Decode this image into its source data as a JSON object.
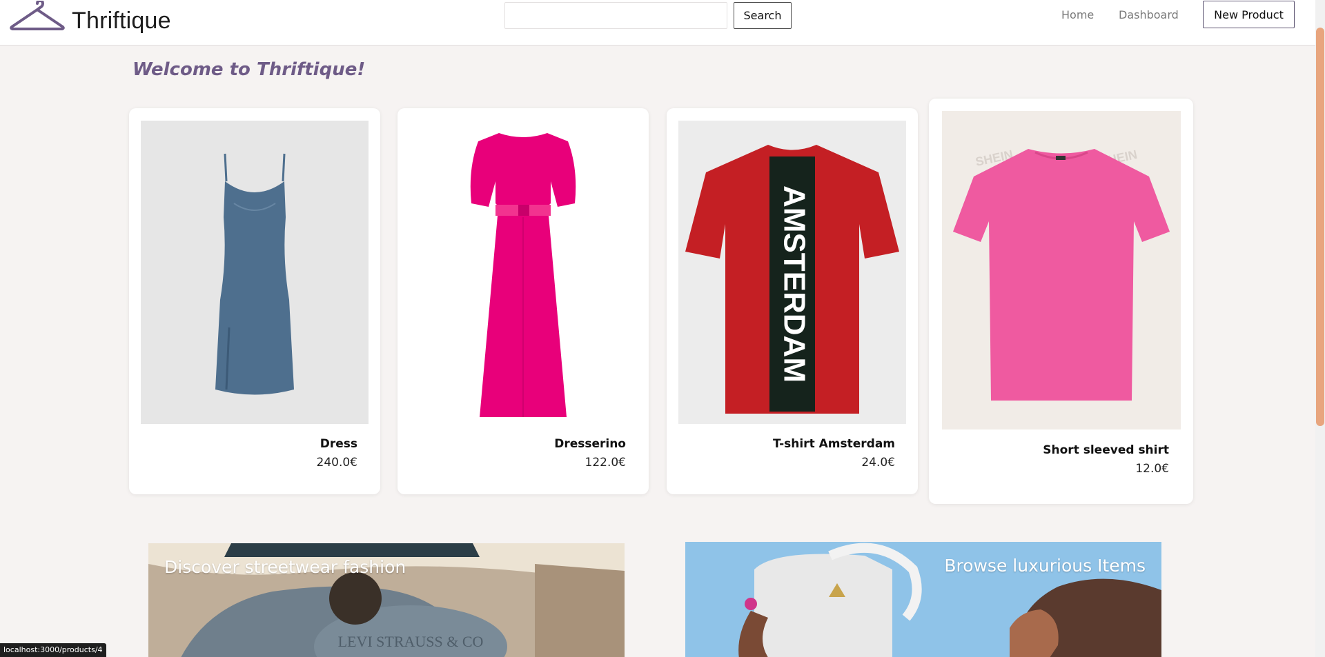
{
  "header": {
    "brand": "Thriftique",
    "search": {
      "value": "",
      "placeholder": "",
      "button_label": "Search"
    },
    "nav": {
      "home": "Home",
      "dashboard": "Dashboard"
    },
    "new_product_label": "New Product"
  },
  "main": {
    "welcome": "Welcome to Thriftique!",
    "products": [
      {
        "name": "Dress",
        "price": "240.0€",
        "color": "#4e6f8e"
      },
      {
        "name": "Dresserino",
        "price": "122.0€",
        "color": "#e8007a"
      },
      {
        "name": "T-shirt Amsterdam",
        "price": "24.0€",
        "color": "#c41f24"
      },
      {
        "name": "Short sleeved shirt",
        "price": "12.0€",
        "color": "#ef5aa0"
      }
    ],
    "banners": [
      {
        "title": "Discover streetwear fashion"
      },
      {
        "title": "Browse luxurious Items"
      }
    ]
  },
  "tshirt_print": "AMSTERDAM",
  "shirt_watermark": "SHEIN",
  "banner_jacket_print": "LEVI STRAUSS & CO",
  "status_url": "localhost:3000/products/4",
  "colors": {
    "accent": "#6e5b87",
    "scrollbar": "#e8a57e",
    "background": "#f6f3f2"
  }
}
